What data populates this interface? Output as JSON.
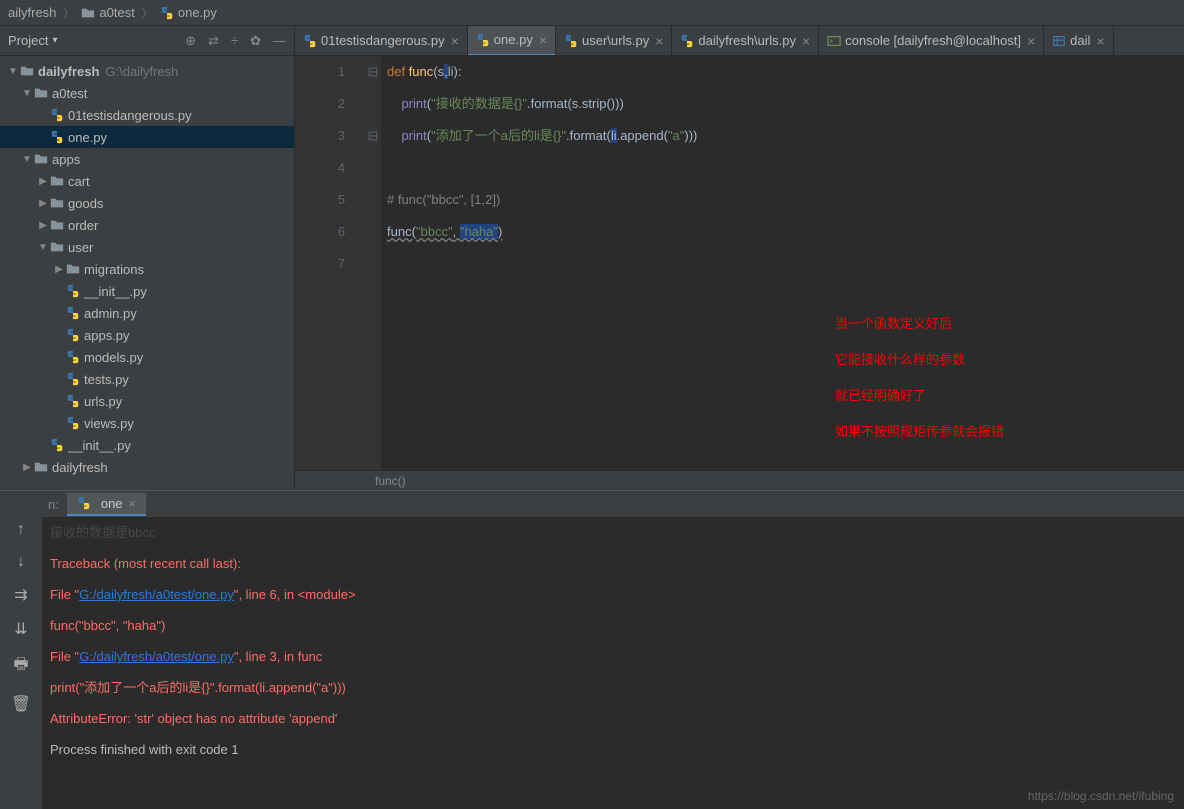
{
  "breadcrumb": {
    "root": "ailyfresh",
    "folder": "a0test",
    "file": "one.py"
  },
  "sidebar": {
    "title": "Project",
    "rootName": "dailyfresh",
    "rootPath": "G:\\dailyfresh",
    "tree": [
      {
        "label": "a0test",
        "open": true,
        "depth": 1,
        "type": "folder"
      },
      {
        "label": "01testisdangerous.py",
        "depth": 2,
        "type": "py"
      },
      {
        "label": "one.py",
        "depth": 2,
        "type": "py",
        "selected": true
      },
      {
        "label": "apps",
        "open": true,
        "depth": 1,
        "type": "folder"
      },
      {
        "label": "cart",
        "depth": 2,
        "type": "folder",
        "closed": true
      },
      {
        "label": "goods",
        "depth": 2,
        "type": "folder",
        "closed": true
      },
      {
        "label": "order",
        "depth": 2,
        "type": "folder",
        "closed": true
      },
      {
        "label": "user",
        "open": true,
        "depth": 2,
        "type": "folder"
      },
      {
        "label": "migrations",
        "depth": 3,
        "type": "folder",
        "closed": true
      },
      {
        "label": "__init__.py",
        "depth": 3,
        "type": "py"
      },
      {
        "label": "admin.py",
        "depth": 3,
        "type": "py"
      },
      {
        "label": "apps.py",
        "depth": 3,
        "type": "py"
      },
      {
        "label": "models.py",
        "depth": 3,
        "type": "py"
      },
      {
        "label": "tests.py",
        "depth": 3,
        "type": "py"
      },
      {
        "label": "urls.py",
        "depth": 3,
        "type": "py"
      },
      {
        "label": "views.py",
        "depth": 3,
        "type": "py"
      },
      {
        "label": "__init__.py",
        "depth": 2,
        "type": "py"
      },
      {
        "label": "dailyfresh",
        "depth": 1,
        "type": "folder",
        "closed": true
      }
    ]
  },
  "tabs": [
    {
      "label": "01testisdangerous.py",
      "type": "py"
    },
    {
      "label": "one.py",
      "type": "py",
      "active": true
    },
    {
      "label": "user\\urls.py",
      "type": "py"
    },
    {
      "label": "dailyfresh\\urls.py",
      "type": "py"
    },
    {
      "label": "console [dailyfresh@localhost]",
      "type": "console"
    },
    {
      "label": "dail",
      "type": "db"
    }
  ],
  "code": {
    "lines": [
      "1",
      "2",
      "3",
      "4",
      "5",
      "6",
      "7"
    ],
    "breadcrumb": "func()"
  },
  "annotations": {
    "l1": "当一个函数定义好后",
    "l2": "它能接收什么样的参数",
    "l3": "就已经明确好了",
    "l4": "如果不按照规矩传参就会报错"
  },
  "runPanel": {
    "labelPrefix": "n:",
    "tabName": "one",
    "output": {
      "cutLine": "接收的数据是bbcc",
      "line1": "Traceback (most recent call last):",
      "file1_pre": "  File \"",
      "file1_link": "G:/dailyfresh/a0test/one.py",
      "file1_post": "\", line 6, in <module>",
      "line3": "    func(\"bbcc\", \"haha\")",
      "file2_pre": "  File \"",
      "file2_link": "G:/dailyfresh/a0test/one.py",
      "file2_post": "\", line 3, in func",
      "line5": "    print(\"添加了一个a后的li是{}\".format(li.append(\"a\")))",
      "line6": "AttributeError: 'str' object has no attribute 'append'",
      "blank": "",
      "exit": "Process finished with exit code 1"
    }
  },
  "watermark": "https://blog.csdn.net/ifubing"
}
